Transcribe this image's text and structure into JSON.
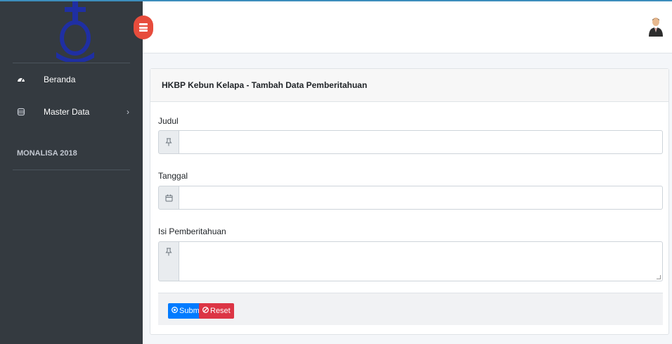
{
  "sidebar": {
    "nav": [
      {
        "label": "Beranda",
        "icon": "dashboard-icon"
      },
      {
        "label": "Master Data",
        "icon": "database-icon",
        "chevron": "›"
      }
    ],
    "header": "MONALISA 2018"
  },
  "card": {
    "title": "HKBP Kebun Kelapa - Tambah Data Pemberitahuan",
    "fields": [
      {
        "label": "Judul",
        "value": "",
        "icon": "pin-icon"
      },
      {
        "label": "Tanggal",
        "value": "",
        "icon": "calendar-icon"
      },
      {
        "label": "Isi Pemberitahuan",
        "value": "",
        "icon": "pin-icon"
      }
    ],
    "buttons": {
      "submit": "Submit",
      "reset": "Reset"
    }
  },
  "colors": {
    "sidebar_bg": "#343a40",
    "primary": "#007bff",
    "danger": "#dc3545",
    "toggle": "#e74c3c",
    "logo": "#1f2fa3"
  }
}
